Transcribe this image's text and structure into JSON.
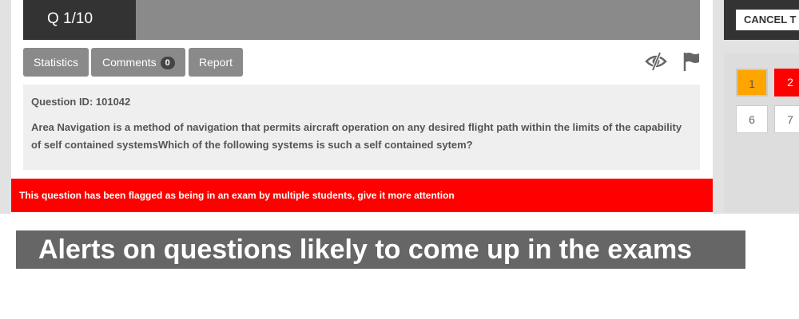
{
  "question_header": {
    "counter": "Q 1/10"
  },
  "tabs": {
    "statistics": "Statistics",
    "comments": "Comments",
    "comments_count": "0",
    "report": "Report"
  },
  "icons": {
    "hide": "eye-slash-icon",
    "flag": "flag-icon"
  },
  "question": {
    "id_label": "Question ID: 101042",
    "text": "Area Navigation is a method of navigation that permits aircraft operation on any desired flight path within the limits of the capability of self contained systemsWhich of the following systems is such a self contained sytem?"
  },
  "alert": {
    "text": "This question has been flagged as being in an exam by multiple students, give it more attention"
  },
  "sidebar": {
    "cancel_label": "CANCEL T",
    "question_numbers": [
      "1",
      "2",
      "6",
      "7"
    ]
  },
  "caption": {
    "text": "Alerts on questions likely to come up in the exams"
  },
  "colors": {
    "alert": "#ff0000",
    "current": "#ffa500",
    "flagged": "#ff0000",
    "header_dark": "#333333",
    "header_grey": "#8a8a8a",
    "caption_bg": "#666666"
  }
}
